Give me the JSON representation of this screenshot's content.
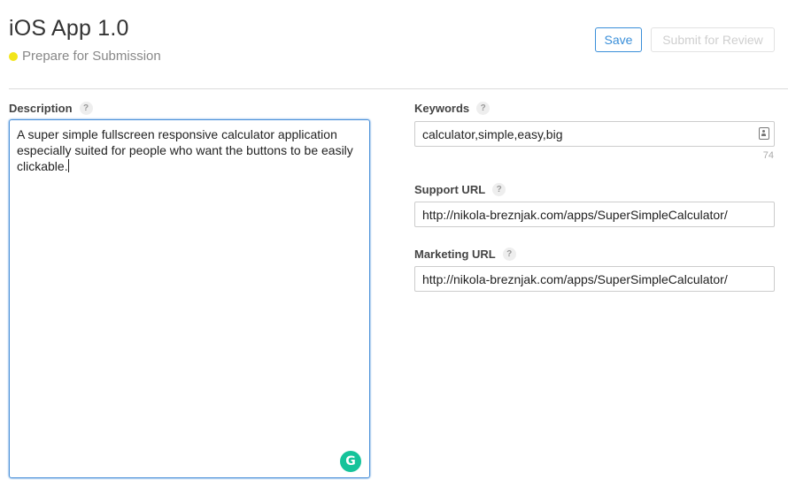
{
  "header": {
    "app_title": "iOS App 1.0",
    "status_text": "Prepare for Submission",
    "status_color": "#f2e51a",
    "save_label": "Save",
    "submit_label": "Submit for Review"
  },
  "description": {
    "label": "Description",
    "help": "?",
    "value": "A super simple fullscreen responsive calculator application especially suited for people who want the buttons to be easily clickable."
  },
  "grammarly": {
    "glyph": "G",
    "color": "#15c39a"
  },
  "keywords": {
    "label": "Keywords",
    "help": "?",
    "value": "calculator,simple,easy,big",
    "remaining": "74"
  },
  "support_url": {
    "label": "Support URL",
    "help": "?",
    "value": "http://nikola-breznjak.com/apps/SuperSimpleCalculator/"
  },
  "marketing_url": {
    "label": "Marketing URL",
    "help": "?",
    "value": "http://nikola-breznjak.com/apps/SuperSimpleCalculator/"
  }
}
